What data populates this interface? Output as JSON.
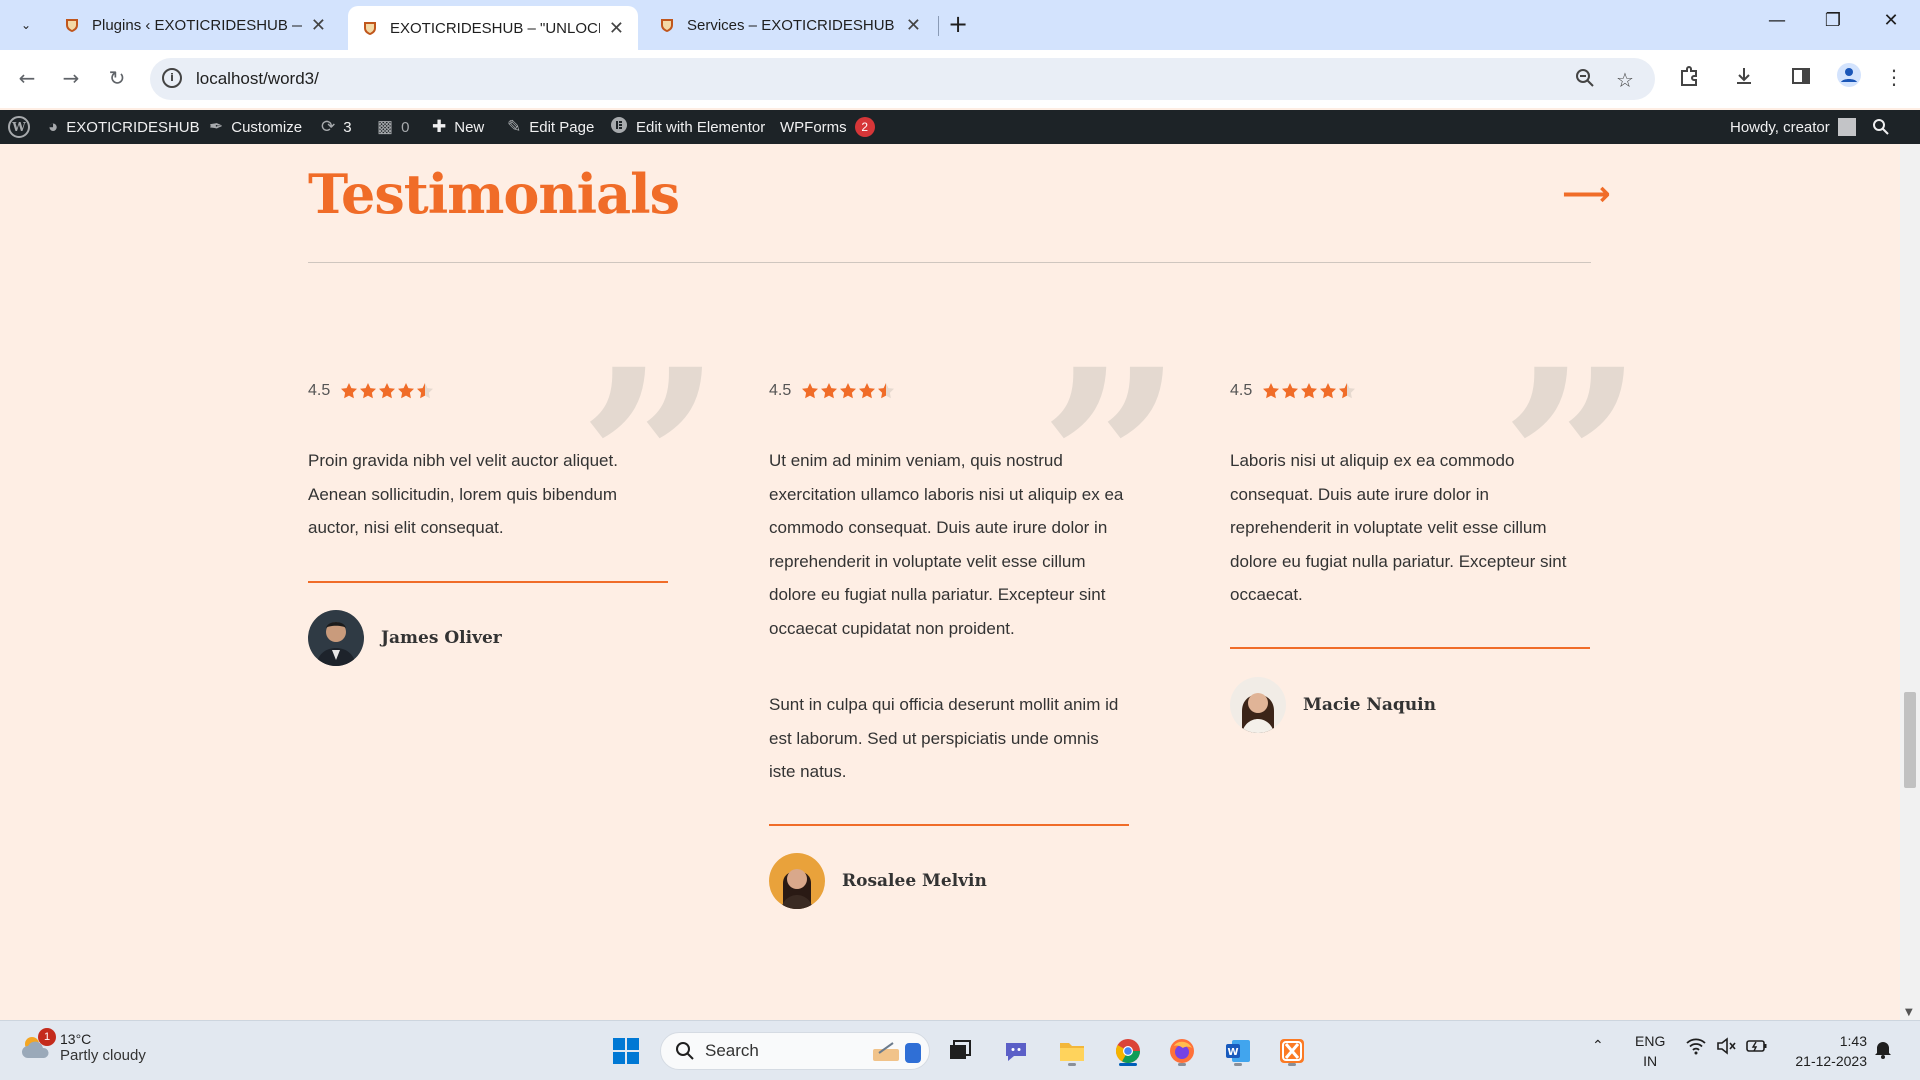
{
  "browser": {
    "tabs": [
      {
        "title": "Plugins ‹ EXOTICRIDESHUB — V",
        "active": false
      },
      {
        "title": "EXOTICRIDESHUB – \"UNLOCK A",
        "active": true
      },
      {
        "title": "Services – EXOTICRIDESHUB",
        "active": false
      }
    ],
    "url": "localhost/word3/"
  },
  "adminbar": {
    "site_name": "EXOTICRIDESHUB",
    "customize": "Customize",
    "updates_count": "3",
    "comments_count": "0",
    "new": "New",
    "edit_page": "Edit Page",
    "edit_elementor": "Edit with Elementor",
    "wpforms": "WPForms",
    "wpforms_badge": "2",
    "howdy": "Howdy, creator"
  },
  "section": {
    "title": "Testimonials",
    "accent_color": "#f06c28"
  },
  "testimonials": [
    {
      "rating": "4.5",
      "rating_value": 4.5,
      "paragraphs": [
        "Proin gravida nibh vel velit auctor aliquet. Aenean sollicitudin, lorem quis bibendum auctor, nisi elit consequat."
      ],
      "author": "James Oliver"
    },
    {
      "rating": "4.5",
      "rating_value": 4.5,
      "paragraphs": [
        "Ut enim ad minim veniam, quis nostrud exercitation ullamco laboris nisi ut aliquip ex ea commodo consequat. Duis aute irure dolor in reprehenderit in voluptate velit esse cillum dolore eu fugiat nulla pariatur. Excepteur sint occaecat cupidatat non proident.",
        "Sunt in culpa qui officia deserunt mollit anim id est laborum. Sed ut perspiciatis unde omnis iste natus."
      ],
      "author": "Rosalee Melvin"
    },
    {
      "rating": "4.5",
      "rating_value": 4.5,
      "paragraphs": [
        "Laboris nisi ut aliquip ex ea commodo consequat. Duis aute irure dolor in reprehenderit in voluptate velit esse cillum dolore eu fugiat nulla pariatur. Excepteur sint occaecat."
      ],
      "author": "Macie Naquin"
    }
  ],
  "taskbar": {
    "weather_temp": "13°C",
    "weather_desc": "Partly cloudy",
    "weather_badge": "1",
    "search_placeholder": "Search",
    "lang_line1": "ENG",
    "lang_line2": "IN",
    "time": "1:43",
    "date": "21-12-2023"
  }
}
